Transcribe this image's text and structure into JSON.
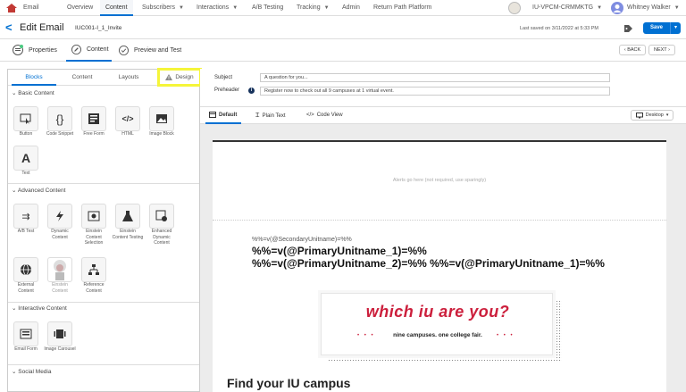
{
  "app": {
    "name": "Email"
  },
  "nav": {
    "items": [
      "Overview",
      "Content",
      "Subscribers",
      "Interactions",
      "A/B Testing",
      "Tracking",
      "Admin",
      "Return Path Platform"
    ],
    "account": "IU-VPCM-CRMMKTG",
    "user": "Whitney Walker"
  },
  "title": {
    "back": "<",
    "heading": "Edit Email",
    "email_name": "IUC001-I_1_Invite",
    "saved": "Last saved on 3/11/2022 at 5:33 PM",
    "save": "Save"
  },
  "tabs": {
    "properties": "Properties",
    "content": "Content",
    "preview": "Preview and Test",
    "back_btn": "BACK",
    "next_btn": "NEXT"
  },
  "left": {
    "tabs": [
      "Blocks",
      "Content",
      "Layouts",
      "Design"
    ],
    "basic": {
      "title": "Basic Content",
      "items": [
        "Button",
        "Code Snippet",
        "Free Form",
        "HTML",
        "Image Block",
        "Text"
      ]
    },
    "advanced": {
      "title": "Advanced Content",
      "items": [
        "A/B Test",
        "Dynamic Content",
        "Einstein Content Selection",
        "Einstein Content Testing",
        "Enhanced Dynamic Content",
        "External Content",
        "Einstein Content",
        "Reference Content"
      ]
    },
    "interactive": {
      "title": "Interactive Content",
      "items": [
        "Email Form",
        "Image Carousel"
      ]
    },
    "social": {
      "title": "Social Media"
    }
  },
  "right": {
    "subject_label": "Subject",
    "subject_value": "A question for you...",
    "preheader_label": "Preheader",
    "preheader_value": "Register now to check out all 9 campuses at 1 virtual event.",
    "view_tabs": [
      "Default",
      "Plain Text",
      "Code View"
    ],
    "device": "Desktop"
  },
  "canvas": {
    "alert": "Alerts go here (not required, use sparingly)",
    "secondary": "%%=v(@SecondaryUnitname)=%%",
    "primary1": "%%=v(@PrimaryUnitname_1)=%%",
    "primary2": "%%=v(@PrimaryUnitname_2)=%% %%=v(@PrimaryUnitname_1)=%%",
    "banner_title": "which iu are you?",
    "banner_sub": "nine campuses. one college fair.",
    "find": "Find your IU campus"
  },
  "colors": {
    "accent": "#0070d2",
    "highlight": "#f5f53a",
    "iu_red": "#cc1f3c"
  }
}
